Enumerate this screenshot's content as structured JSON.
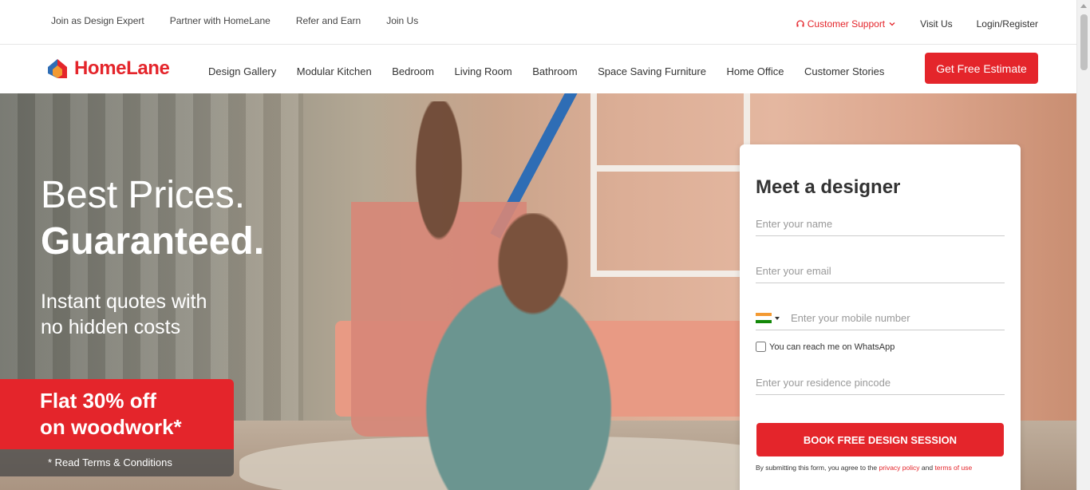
{
  "topbar": {
    "left_links": [
      "Join as Design Expert",
      "Partner with HomeLane",
      "Refer and Earn",
      "Join Us"
    ],
    "customer_support": "Customer Support",
    "visit_us": "Visit Us",
    "login": "Login/Register"
  },
  "navbar": {
    "logo_text": "HomeLane",
    "links": [
      "Design Gallery",
      "Modular Kitchen",
      "Bedroom",
      "Living Room",
      "Bathroom",
      "Space Saving Furniture",
      "Home Office",
      "Customer Stories"
    ],
    "cta": "Get Free Estimate"
  },
  "hero": {
    "headline_line1": "Best Prices.",
    "headline_line2": "Guaranteed.",
    "sub_line1": "Instant quotes with",
    "sub_line2": "no hidden costs",
    "offer_line1": "Flat 30% off",
    "offer_line2": "on woodwork*",
    "terms": "* Read Terms & Conditions"
  },
  "form": {
    "title": "Meet a designer",
    "name_placeholder": "Enter your name",
    "email_placeholder": "Enter your email",
    "phone_placeholder": "Enter your mobile number",
    "whatsapp_label": "You can reach me on WhatsApp",
    "pincode_placeholder": "Enter your residence pincode",
    "submit": "BOOK FREE DESIGN SESSION",
    "disclaimer_prefix": "By submitting this form, you agree to the ",
    "privacy_link": "privacy policy",
    "disclaimer_and": " and ",
    "terms_link": "terms of use"
  },
  "colors": {
    "brand_red": "#e4252b"
  }
}
